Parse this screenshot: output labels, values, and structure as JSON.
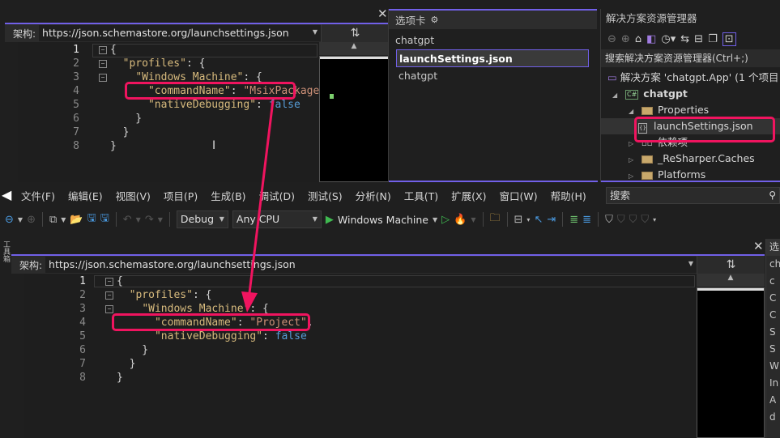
{
  "top_editor": {
    "schema_label": "架构:",
    "schema_url": "https://json.schemastore.org/launchsettings.json",
    "lines": [
      {
        "n": "1",
        "fold": "⊟",
        "code": [
          {
            "t": "{",
            "c": "p"
          }
        ]
      },
      {
        "n": "2",
        "fold": "⊟",
        "code": [
          {
            "t": "  ",
            "c": "p"
          },
          {
            "t": "\"profiles\"",
            "c": "key"
          },
          {
            "t": ": {",
            "c": "p"
          }
        ]
      },
      {
        "n": "3",
        "fold": "⊟",
        "code": [
          {
            "t": "    ",
            "c": "p"
          },
          {
            "t": "\"Windows Machine\"",
            "c": "key"
          },
          {
            "t": ": {",
            "c": "p"
          }
        ]
      },
      {
        "n": "4",
        "fold": "",
        "code": [
          {
            "t": "      ",
            "c": "p"
          },
          {
            "t": "\"commandName\"",
            "c": "key"
          },
          {
            "t": ": ",
            "c": "p"
          },
          {
            "t": "\"MsixPackage\"",
            "c": "s"
          },
          {
            "t": ",",
            "c": "p"
          }
        ]
      },
      {
        "n": "5",
        "fold": "",
        "code": [
          {
            "t": "      ",
            "c": "p"
          },
          {
            "t": "\"nativeDebugging\"",
            "c": "key"
          },
          {
            "t": ": ",
            "c": "p"
          },
          {
            "t": "false",
            "c": "b"
          }
        ]
      },
      {
        "n": "6",
        "fold": "",
        "code": [
          {
            "t": "    }",
            "c": "p"
          }
        ]
      },
      {
        "n": "7",
        "fold": "",
        "code": [
          {
            "t": "  }",
            "c": "p"
          }
        ]
      },
      {
        "n": "8",
        "fold": "",
        "code": [
          {
            "t": "}",
            "c": "p"
          }
        ]
      }
    ]
  },
  "tab_well": {
    "title": "选项卡",
    "items": [
      {
        "label": "chatgpt",
        "selected": false
      },
      {
        "label": "launchSettings.json",
        "selected": true
      },
      {
        "label": "chatgpt",
        "selected": false
      }
    ]
  },
  "solution_explorer": {
    "title": "解决方案资源管理器",
    "search_placeholder": "搜索解决方案资源管理器(Ctrl+;)",
    "tree": [
      {
        "label": "解决方案 'chatgpt.App' (1 个项目",
        "icon": "solution-icon",
        "indent": 0,
        "toggle": ""
      },
      {
        "label": "chatgpt",
        "icon": "csharp-project-icon",
        "indent": 1,
        "toggle": "◢",
        "bold": true
      },
      {
        "label": "Properties",
        "icon": "properties-folder-icon",
        "indent": 2,
        "toggle": "◢"
      },
      {
        "label": "launchSettings.json",
        "icon": "json-file-icon",
        "indent": 3,
        "toggle": "",
        "selected": true
      },
      {
        "label": "依赖项",
        "icon": "dependencies-icon",
        "indent": 2,
        "toggle": "▷"
      },
      {
        "label": "_ReSharper.Caches",
        "icon": "folder-icon",
        "indent": 2,
        "toggle": "▷"
      },
      {
        "label": "Platforms",
        "icon": "folder-icon",
        "indent": 2,
        "toggle": "▷"
      }
    ]
  },
  "menubar": {
    "items": [
      "文件(F)",
      "编辑(E)",
      "视图(V)",
      "项目(P)",
      "生成(B)",
      "调试(D)",
      "测试(S)",
      "分析(N)",
      "工具(T)",
      "扩展(X)",
      "窗口(W)",
      "帮助(H)"
    ],
    "search_label": "搜索"
  },
  "toolbar": {
    "config": "Debug",
    "platform": "Any CPU",
    "run_target": "Windows Machine"
  },
  "bottom_editor": {
    "side_tab": "工具箱",
    "schema_label": "架构:",
    "schema_url": "https://json.schemastore.org/launchsettings.json",
    "lines": [
      {
        "n": "1",
        "fold": "⊟",
        "code": [
          {
            "t": "{",
            "c": "p"
          }
        ]
      },
      {
        "n": "2",
        "fold": "⊟",
        "code": [
          {
            "t": "  ",
            "c": "p"
          },
          {
            "t": "\"profiles\"",
            "c": "key"
          },
          {
            "t": ": {",
            "c": "p"
          }
        ]
      },
      {
        "n": "3",
        "fold": "⊟",
        "code": [
          {
            "t": "    ",
            "c": "p"
          },
          {
            "t": "\"Windows Machine\"",
            "c": "key"
          },
          {
            "t": ": {",
            "c": "p"
          }
        ]
      },
      {
        "n": "4",
        "fold": "",
        "code": [
          {
            "t": "      ",
            "c": "p"
          },
          {
            "t": "\"commandName\"",
            "c": "key"
          },
          {
            "t": ": ",
            "c": "p"
          },
          {
            "t": "\"Project\"",
            "c": "s"
          },
          {
            "t": ",",
            "c": "p"
          }
        ]
      },
      {
        "n": "5",
        "fold": "",
        "code": [
          {
            "t": "      ",
            "c": "p"
          },
          {
            "t": "\"nativeDebugging\"",
            "c": "key"
          },
          {
            "t": ": ",
            "c": "p"
          },
          {
            "t": "false",
            "c": "b"
          }
        ]
      },
      {
        "n": "6",
        "fold": "",
        "code": [
          {
            "t": "    }",
            "c": "p"
          }
        ]
      },
      {
        "n": "7",
        "fold": "",
        "code": [
          {
            "t": "  }",
            "c": "p"
          }
        ]
      },
      {
        "n": "8",
        "fold": "",
        "code": [
          {
            "t": "}",
            "c": "p"
          }
        ]
      }
    ],
    "right_strip": {
      "header": "选",
      "items": [
        "ch",
        "c",
        "C",
        "C",
        "S",
        "S",
        "W",
        "In",
        "A",
        "d"
      ]
    }
  },
  "colors": {
    "accent": "#7160e8",
    "highlight": "#f0145f",
    "string": "#ce9178",
    "key": "#d7ba7d",
    "keyword": "#569cd6"
  }
}
